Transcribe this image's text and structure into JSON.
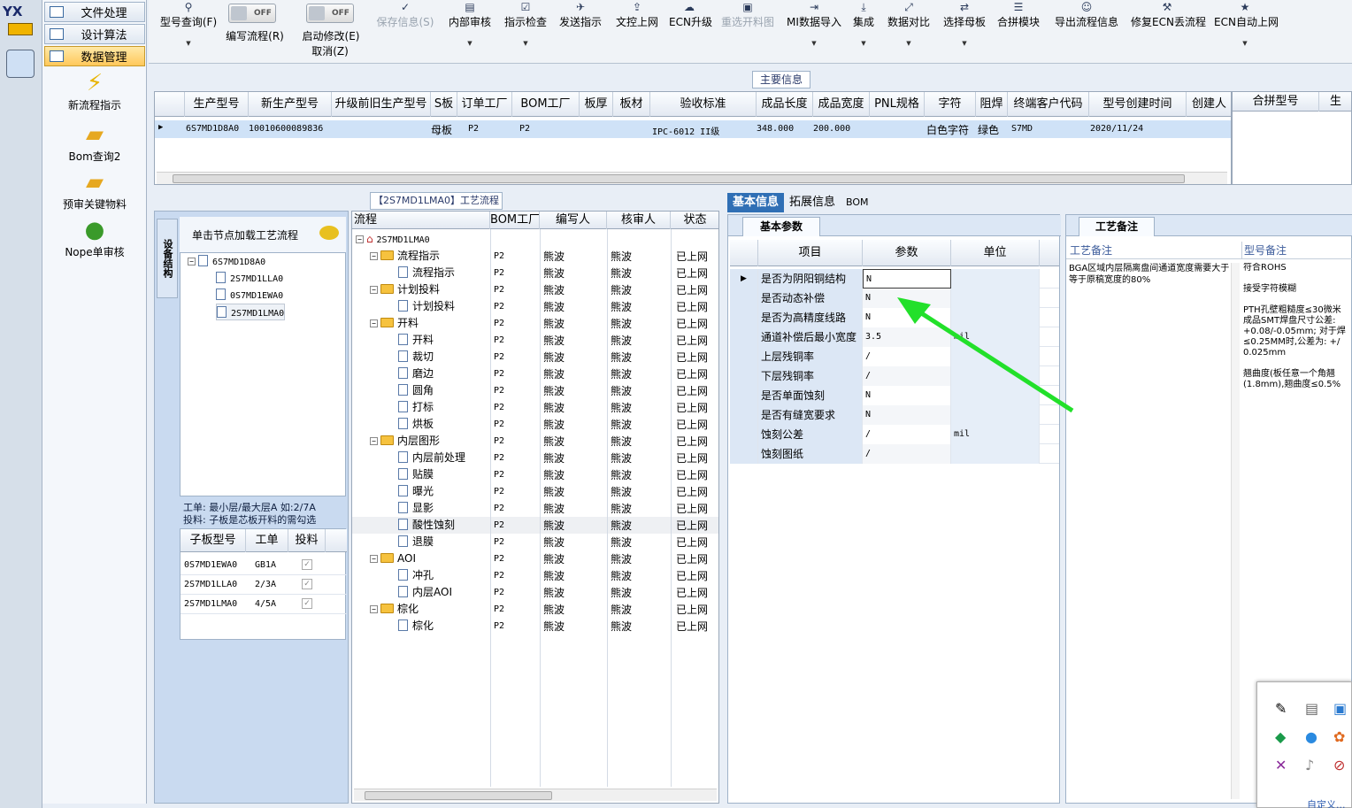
{
  "app": {
    "logo_text": "YX"
  },
  "menu": {
    "items": [
      {
        "label": "文件处理"
      },
      {
        "label": "设计算法"
      },
      {
        "label": "数据管理"
      }
    ],
    "bigbuttons": [
      {
        "label": "新流程指示",
        "icon": "lightning-icon"
      },
      {
        "label": "Bom查询2",
        "icon": "folder-icon"
      },
      {
        "label": "预审关键物料",
        "icon": "folder-icon"
      },
      {
        "label": "Nope单审核",
        "icon": "user-icon"
      }
    ]
  },
  "toolbar": {
    "model_query": "型号查询(F)",
    "edit_flow_label": "编写流程(R)",
    "edit_flow_state": "OFF",
    "enable_modify_label": "启动修改(E)",
    "enable_modify_state": "OFF",
    "cancel": "取消(Z)",
    "save": "保存信息(S)",
    "internal_review": "内部审核",
    "check": "指示检查",
    "send": "发送指示",
    "doc_online": "文控上网",
    "ecn_upgrade": "ECN升级",
    "redraw": "重选开料图",
    "mi_import": "MI数据导入",
    "integrate": "集成",
    "compare": "数据对比",
    "select_board": "选择母板",
    "merge": "合拼模块",
    "export": "导出流程信息",
    "fix_ecn": "修复ECN丢流程",
    "ecn_auto": "ECN自动上网"
  },
  "main_info": {
    "title": "主要信息",
    "columns": [
      "生产型号",
      "新生产型号",
      "升级前旧生产型号",
      "S板",
      "订单工厂",
      "BOM工厂",
      "板厚",
      "板材",
      "验收标准",
      "成品长度",
      "成品宽度",
      "PNL规格",
      "字符",
      "阻焊",
      "终端客户代码",
      "型号创建时间",
      "创建人"
    ],
    "row": {
      "model": "6S7MD1D8A0",
      "new_model": "10010600089836",
      "s_board": "母板",
      "order_factory": "P2",
      "bom_factory": "P2",
      "standard": "IPC-6012 II级",
      "length": "348.000",
      "width": "200.000",
      "char": "白色字符",
      "solder": "绿色",
      "customer": "S7MD",
      "created": "2020/11/24"
    },
    "side_columns": [
      "合拼型号",
      "生"
    ]
  },
  "flow_panel": {
    "title": "【2S7MD1LMA0】工艺流程",
    "vertical_tab": "设备结构",
    "hint_header": "单击节点加载工艺流程",
    "tree": [
      "6S7MD1D8A0",
      "2S7MD1LLA0",
      "0S7MD1EWA0",
      "2S7MD1LMA0"
    ],
    "note_line1": "工单: 最小层/最大层A 如:2/7A",
    "note_line2": "投料: 子板是芯板开料的需勾选",
    "sub_columns": [
      "子板型号",
      "工单",
      "投料"
    ],
    "sub_rows": [
      {
        "model": "0S7MD1EWA0",
        "order": "GB1A"
      },
      {
        "model": "2S7MD1LLA0",
        "order": "2/3A"
      },
      {
        "model": "2S7MD1LMA0",
        "order": "4/5A"
      }
    ]
  },
  "process_grid": {
    "columns": [
      "流程",
      "BOM工厂",
      "编写人",
      "核审人",
      "状态"
    ],
    "root": "2S7MD1LMA0",
    "rows": [
      {
        "name": "流程指示",
        "folder": true
      },
      {
        "name": "流程指示",
        "folder": false
      },
      {
        "name": "计划投料",
        "folder": true
      },
      {
        "name": "计划投料",
        "folder": false
      },
      {
        "name": "开料",
        "folder": true
      },
      {
        "name": "开料",
        "folder": false
      },
      {
        "name": "裁切",
        "folder": false
      },
      {
        "name": "磨边",
        "folder": false
      },
      {
        "name": "圆角",
        "folder": false
      },
      {
        "name": "打标",
        "folder": false
      },
      {
        "name": "烘板",
        "folder": false
      },
      {
        "name": "内层图形",
        "folder": true
      },
      {
        "name": "内层前处理",
        "folder": false
      },
      {
        "name": "贴膜",
        "folder": false
      },
      {
        "name": "曝光",
        "folder": false
      },
      {
        "name": "显影",
        "folder": false
      },
      {
        "name": "酸性蚀刻",
        "folder": false
      },
      {
        "name": "退膜",
        "folder": false
      },
      {
        "name": "AOI",
        "folder": true
      },
      {
        "name": "冲孔",
        "folder": false
      },
      {
        "name": "内层AOI",
        "folder": false
      },
      {
        "name": "棕化",
        "folder": true
      },
      {
        "name": "棕化",
        "folder": false
      }
    ],
    "bom": "P2",
    "writer": "熊波",
    "reviewer": "熊波",
    "status": "已上网"
  },
  "detail": {
    "tabs": [
      "基本信息",
      "拓展信息",
      "BOM"
    ],
    "basic_title": "基本参数",
    "columns": [
      "项目",
      "参数",
      "单位"
    ],
    "params": [
      {
        "item": "是否为阴阳铜结构",
        "value": "N",
        "unit": ""
      },
      {
        "item": "是否动态补偿",
        "value": "N",
        "unit": ""
      },
      {
        "item": "是否为高精度线路",
        "value": "N",
        "unit": ""
      },
      {
        "item": "通道补偿后最小宽度",
        "value": "3.5",
        "unit": "mil"
      },
      {
        "item": "上层残铜率",
        "value": "/",
        "unit": ""
      },
      {
        "item": "下层残铜率",
        "value": "/",
        "unit": ""
      },
      {
        "item": "是否单面蚀刻",
        "value": "N",
        "unit": ""
      },
      {
        "item": "是否有缝宽要求",
        "value": "N",
        "unit": ""
      },
      {
        "item": "蚀刻公差",
        "value": "/",
        "unit": "mil"
      },
      {
        "item": "蚀刻图纸",
        "value": "/",
        "unit": ""
      }
    ]
  },
  "remarks": {
    "title": "工艺备注",
    "col1": "工艺备注",
    "col2": "型号备注",
    "process_note": "BGA区域内层隔离盘间通道宽度需要大于等于原稿宽度的80%",
    "model_note_1": "符合ROHS",
    "model_note_2": "接受字符模糊",
    "model_note_3": "PTH孔壁粗糙度≤30微米",
    "model_note_4": "成品SMT焊盘尺寸公差:",
    "model_note_5": "+0.08/-0.05mm; 对于焊",
    "model_note_6": "≤0.25MM时,公差为: +/",
    "model_note_7": "0.025mm",
    "model_note_8": "翘曲度(板任意一个角翘",
    "model_note_9": "(1.8mm),翘曲度≤0.5%"
  },
  "tray": {
    "customize": "自定义..."
  },
  "colors": {
    "accent": "#2f6fb5",
    "arrow": "#22e02a",
    "selected_row": "#cfe2f7"
  }
}
